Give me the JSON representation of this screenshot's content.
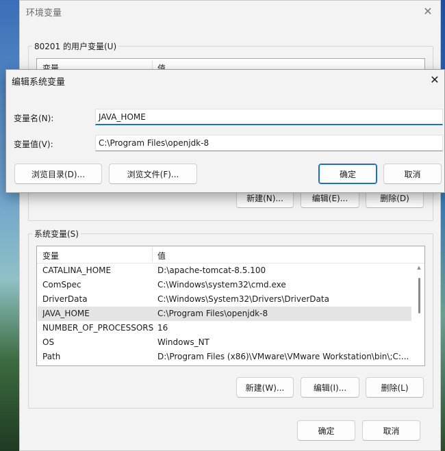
{
  "main_window": {
    "title": "环境变量",
    "close_glyph": "✕",
    "user_group_label": "80201 的用户变量(U)",
    "user_list": {
      "columns": [
        "变量",
        "值"
      ]
    },
    "user_buttons": {
      "new": "新建(N)...",
      "edit": "编辑(E)...",
      "delete": "删除(D)"
    },
    "system_group_label": "系统变量(S)",
    "system_list": {
      "columns": [
        "变量",
        "值"
      ],
      "rows": [
        {
          "name": "CATALINA_HOME",
          "value": "D:\\apache-tomcat-8.5.100"
        },
        {
          "name": "ComSpec",
          "value": "C:\\Windows\\system32\\cmd.exe"
        },
        {
          "name": "DriverData",
          "value": "C:\\Windows\\System32\\Drivers\\DriverData"
        },
        {
          "name": "JAVA_HOME",
          "value": "C:\\Program Files\\openjdk-8"
        },
        {
          "name": "NUMBER_OF_PROCESSORS",
          "value": "16"
        },
        {
          "name": "OS",
          "value": "Windows_NT"
        },
        {
          "name": "Path",
          "value": "D:\\Program Files (x86)\\VMware\\VMware Workstation\\bin\\;C:..."
        }
      ],
      "selected_index": 3
    },
    "system_buttons": {
      "new": "新建(W)...",
      "edit": "编辑(I)...",
      "delete": "删除(L)"
    },
    "footer_buttons": {
      "ok": "确定",
      "cancel": "取消"
    }
  },
  "edit_dialog": {
    "title": "编辑系统变量",
    "close_glyph": "✕",
    "name_label": "变量名(N):",
    "name_value": "JAVA_HOME",
    "value_label": "变量值(V):",
    "value_value": "C:\\Program Files\\openjdk-8",
    "browse_dir": "浏览目录(D)...",
    "browse_file": "浏览文件(F)...",
    "ok": "确定",
    "cancel": "取消"
  },
  "colors": {
    "accent": "#1e6fbf",
    "window_bg": "#f3f3f3",
    "selected_row": "#e5e5e5"
  }
}
